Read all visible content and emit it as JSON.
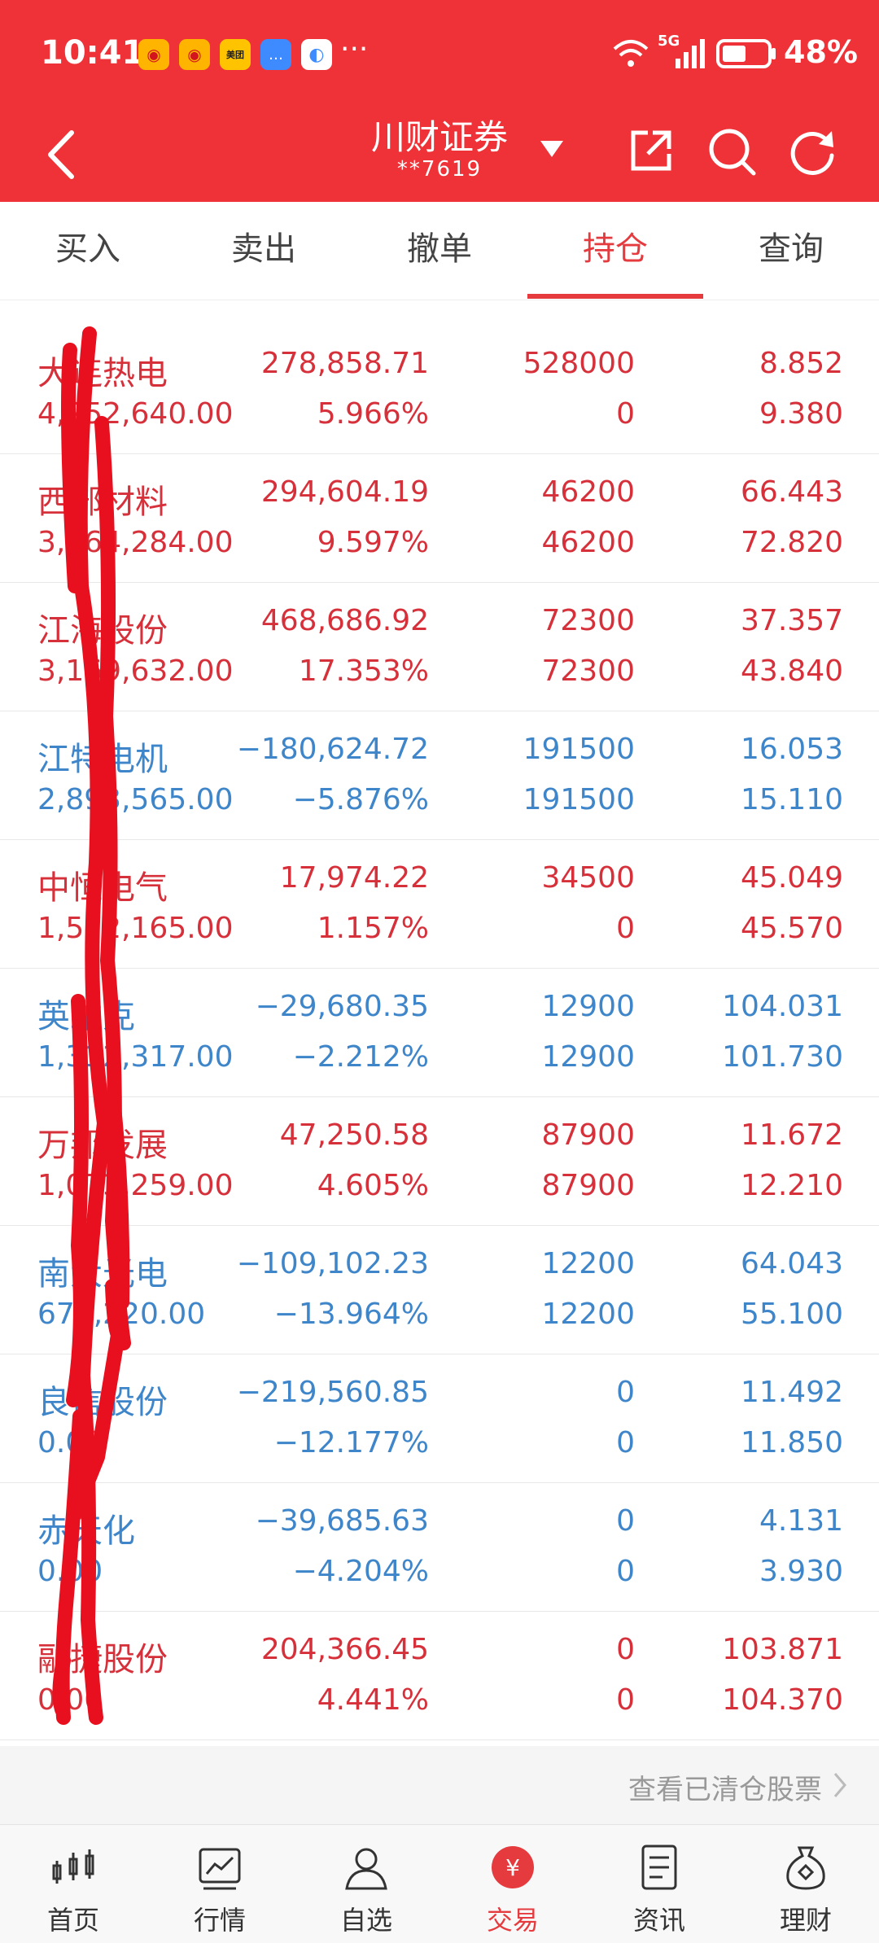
{
  "status_bar": {
    "time": "10:41",
    "network": "5G",
    "battery": "48%"
  },
  "topbar": {
    "title": "川财证券",
    "account": "**7619"
  },
  "tabs": [
    "买入",
    "卖出",
    "撤单",
    "持仓",
    "查询"
  ],
  "active_tab": "持仓",
  "holdings": [
    {
      "name": "大连热电",
      "market_value": "4,252,640.00",
      "profit": "278,858.71",
      "profit_pct": "5.966%",
      "qty": "528000",
      "available": "0",
      "cost": "8.852",
      "price": "9.380",
      "trend": "up"
    },
    {
      "name": "西部材料",
      "market_value": "3,364,284.00",
      "profit": "294,604.19",
      "profit_pct": "9.597%",
      "qty": "46200",
      "available": "46200",
      "cost": "66.443",
      "price": "72.820",
      "trend": "up"
    },
    {
      "name": "江海股份",
      "market_value": "3,169,632.00",
      "profit": "468,686.92",
      "profit_pct": "17.353%",
      "qty": "72300",
      "available": "72300",
      "cost": "37.357",
      "price": "43.840",
      "trend": "up"
    },
    {
      "name": "江特电机",
      "market_value": "2,893,565.00",
      "profit": "−180,624.72",
      "profit_pct": "−5.876%",
      "qty": "191500",
      "available": "191500",
      "cost": "16.053",
      "price": "15.110",
      "trend": "down"
    },
    {
      "name": "中恒电气",
      "market_value": "1,572,165.00",
      "profit": "17,974.22",
      "profit_pct": "1.157%",
      "qty": "34500",
      "available": "0",
      "cost": "45.049",
      "price": "45.570",
      "trend": "up"
    },
    {
      "name": "英维克",
      "market_value": "1,312,317.00",
      "profit": "−29,680.35",
      "profit_pct": "−2.212%",
      "qty": "12900",
      "available": "12900",
      "cost": "104.031",
      "price": "101.730",
      "trend": "down"
    },
    {
      "name": "万邦发展",
      "market_value": "1,073,259.00",
      "profit": "47,250.58",
      "profit_pct": "4.605%",
      "qty": "87900",
      "available": "87900",
      "cost": "11.672",
      "price": "12.210",
      "trend": "up"
    },
    {
      "name": "南大光电",
      "market_value": "672,220.00",
      "profit": "−109,102.23",
      "profit_pct": "−13.964%",
      "qty": "12200",
      "available": "12200",
      "cost": "64.043",
      "price": "55.100",
      "trend": "down"
    },
    {
      "name": "良信股份",
      "market_value": "0.00",
      "profit": "−219,560.85",
      "profit_pct": "−12.177%",
      "qty": "0",
      "available": "0",
      "cost": "11.492",
      "price": "11.850",
      "trend": "down"
    },
    {
      "name": "赤天化",
      "market_value": "0.00",
      "profit": "−39,685.63",
      "profit_pct": "−4.204%",
      "qty": "0",
      "available": "0",
      "cost": "4.131",
      "price": "3.930",
      "trend": "down"
    },
    {
      "name": "融捷股份",
      "market_value": "0.00",
      "profit": "204,366.45",
      "profit_pct": "4.441%",
      "qty": "0",
      "available": "0",
      "cost": "103.871",
      "price": "104.370",
      "trend": "up"
    }
  ],
  "cleared_link": "查看已清仓股票",
  "bottom_nav": [
    {
      "label": "首页",
      "icon": "candlestick-icon"
    },
    {
      "label": "行情",
      "icon": "chart-icon"
    },
    {
      "label": "自选",
      "icon": "person-icon"
    },
    {
      "label": "交易",
      "icon": "yuan-icon"
    },
    {
      "label": "资讯",
      "icon": "news-icon"
    },
    {
      "label": "理财",
      "icon": "money-bag-icon"
    }
  ],
  "colors": {
    "header": "#ee3237",
    "up": "#d6303a",
    "down": "#3e86c9",
    "active": "#e53b3f"
  }
}
